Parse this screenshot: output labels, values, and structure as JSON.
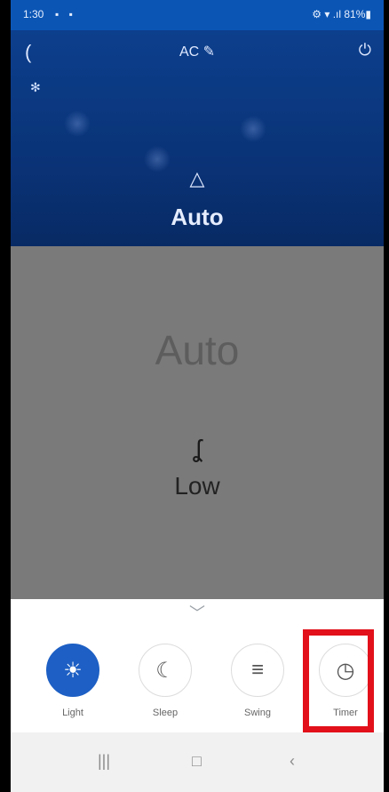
{
  "status_bar": {
    "time": "1:30",
    "left_icons": "▪ ▪",
    "right_icons": "⚙ ▾ .ıl 81%▮"
  },
  "header": {
    "title": "AC ✎",
    "back": "(",
    "power": "⏻",
    "snow": "✻",
    "mode_icon": "△",
    "mode_label": "Auto"
  },
  "display": {
    "mode_text": "Auto",
    "fan_icon": "ʆ",
    "fan_speed": "Low"
  },
  "controls": {
    "chevron": "﹀",
    "items": [
      {
        "label": "Light",
        "icon": "☀"
      },
      {
        "label": "Sleep",
        "icon": "☾"
      },
      {
        "label": "Swing",
        "icon": "≡"
      },
      {
        "label": "Timer",
        "icon": "◷"
      }
    ]
  },
  "nav": {
    "recents": "|||",
    "home": "□",
    "back": "‹"
  },
  "colors": {
    "accent": "#1d5fc4",
    "highlight": "#e2101a",
    "header": "#0a3377"
  }
}
